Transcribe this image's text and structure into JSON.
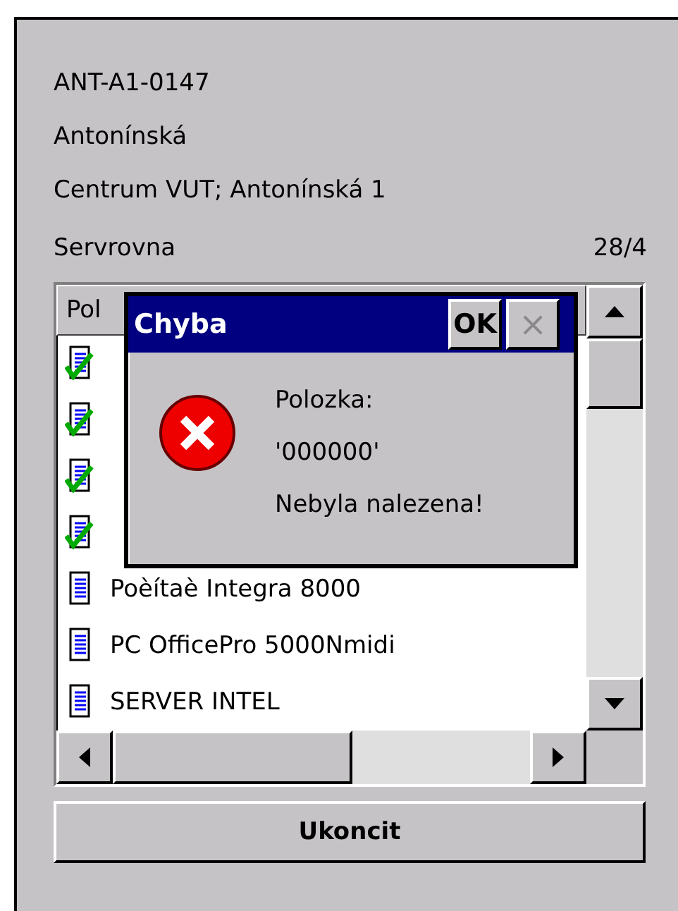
{
  "info_lines": [
    {
      "text": "ANT-A1-0147"
    },
    {
      "text": "Antonínská"
    },
    {
      "text": "Centrum VUT; Antonínská 1"
    }
  ],
  "room": {
    "name": "Servrovna",
    "count": "28/4"
  },
  "list": {
    "column_1": "Pol",
    "rows": [
      {
        "checked": true
      },
      {
        "checked": true
      },
      {
        "checked": true
      },
      {
        "checked": true
      },
      {
        "checked": false,
        "label": "Poèítaè Integra 8000"
      },
      {
        "checked": false,
        "label": "PC OfficePro 5000Nmidi"
      },
      {
        "checked": false,
        "label": "SERVER INTEL"
      }
    ]
  },
  "button": "Ukoncit",
  "dialog": {
    "title": "Chyba",
    "ok": "OK",
    "close": "×",
    "close_disabled": true,
    "lines": [
      "Polozka:",
      "'000000'",
      "Nebyla nalezena!"
    ]
  }
}
